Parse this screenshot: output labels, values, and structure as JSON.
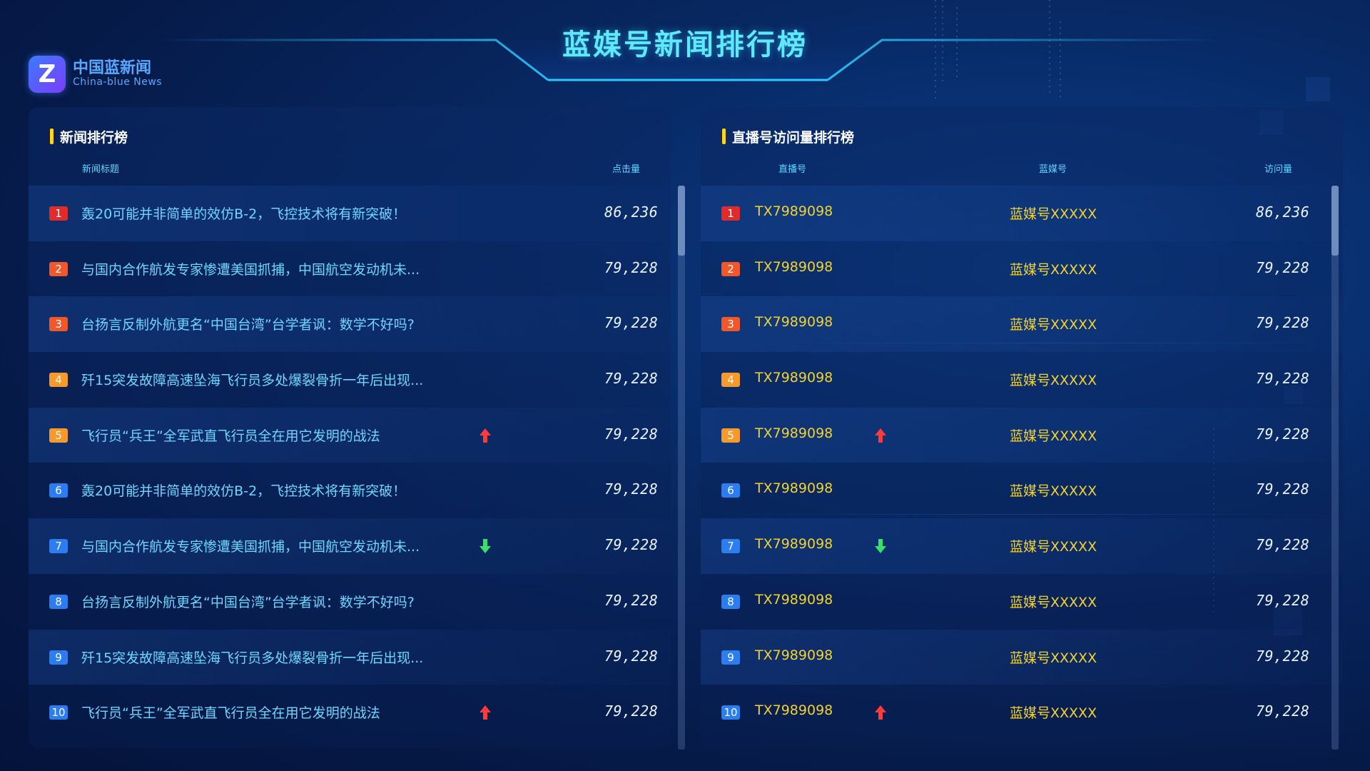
{
  "header": {
    "title": "蓝媒号新闻排行榜",
    "logo": {
      "mark": "Z",
      "cn": "中国蓝新闻",
      "en": "China-blue News"
    }
  },
  "colors": {
    "rank1": "#e02b2b",
    "rank2": "#f0572b",
    "rank3": "#f0572b",
    "rank4": "#f59a2b",
    "rank5": "#f59a2b",
    "rank_other": "#2b7df0",
    "up": "#ff3b3b",
    "down": "#38e06a"
  },
  "news": {
    "title": "新闻排行榜",
    "col_title": "新闻标题",
    "col_clicks": "点击量",
    "rows": [
      {
        "rank": "1",
        "title": "轰20可能并非简单的效仿B-2，飞控技术将有新突破！",
        "value": "86,236",
        "trend": ""
      },
      {
        "rank": "2",
        "title": "与国内合作航发专家惨遭美国抓捕，中国航空发动机未...",
        "value": "79,228",
        "trend": ""
      },
      {
        "rank": "3",
        "title": "台扬言反制外航更名“中国台湾”台学者讽：数学不好吗?",
        "value": "79,228",
        "trend": ""
      },
      {
        "rank": "4",
        "title": "歼15突发故障高速坠海飞行员多处爆裂骨折一年后出现...",
        "value": "79,228",
        "trend": ""
      },
      {
        "rank": "5",
        "title": "飞行员“兵王”全军武直飞行员全在用它发明的战法",
        "value": "79,228",
        "trend": "up"
      },
      {
        "rank": "6",
        "title": "轰20可能并非简单的效仿B-2，飞控技术将有新突破！",
        "value": "79,228",
        "trend": ""
      },
      {
        "rank": "7",
        "title": "与国内合作航发专家惨遭美国抓捕，中国航空发动机未...",
        "value": "79,228",
        "trend": "down"
      },
      {
        "rank": "8",
        "title": "台扬言反制外航更名“中国台湾”台学者讽：数学不好吗?",
        "value": "79,228",
        "trend": ""
      },
      {
        "rank": "9",
        "title": "歼15突发故障高速坠海飞行员多处爆裂骨折一年后出现...",
        "value": "79,228",
        "trend": ""
      },
      {
        "rank": "10",
        "title": "飞行员“兵王”全军武直飞行员全在用它发明的战法",
        "value": "79,228",
        "trend": "up"
      }
    ]
  },
  "live": {
    "title": "直播号访问量排行榜",
    "col_code": "直播号",
    "col_media": "蓝媒号",
    "col_visits": "访问量",
    "rows": [
      {
        "rank": "1",
        "code": "TX7989098",
        "media": "蓝媒号XXXXX",
        "value": "86,236",
        "trend": ""
      },
      {
        "rank": "2",
        "code": "TX7989098",
        "media": "蓝媒号XXXXX",
        "value": "79,228",
        "trend": ""
      },
      {
        "rank": "3",
        "code": "TX7989098",
        "media": "蓝媒号XXXXX",
        "value": "79,228",
        "trend": ""
      },
      {
        "rank": "4",
        "code": "TX7989098",
        "media": "蓝媒号XXXXX",
        "value": "79,228",
        "trend": ""
      },
      {
        "rank": "5",
        "code": "TX7989098",
        "media": "蓝媒号XXXXX",
        "value": "79,228",
        "trend": "up"
      },
      {
        "rank": "6",
        "code": "TX7989098",
        "media": "蓝媒号XXXXX",
        "value": "79,228",
        "trend": ""
      },
      {
        "rank": "7",
        "code": "TX7989098",
        "media": "蓝媒号XXXXX",
        "value": "79,228",
        "trend": "down"
      },
      {
        "rank": "8",
        "code": "TX7989098",
        "media": "蓝媒号XXXXX",
        "value": "79,228",
        "trend": ""
      },
      {
        "rank": "9",
        "code": "TX7989098",
        "media": "蓝媒号XXXXX",
        "value": "79,228",
        "trend": ""
      },
      {
        "rank": "10",
        "code": "TX7989098",
        "media": "蓝媒号XXXXX",
        "value": "79,228",
        "trend": "up"
      }
    ]
  }
}
